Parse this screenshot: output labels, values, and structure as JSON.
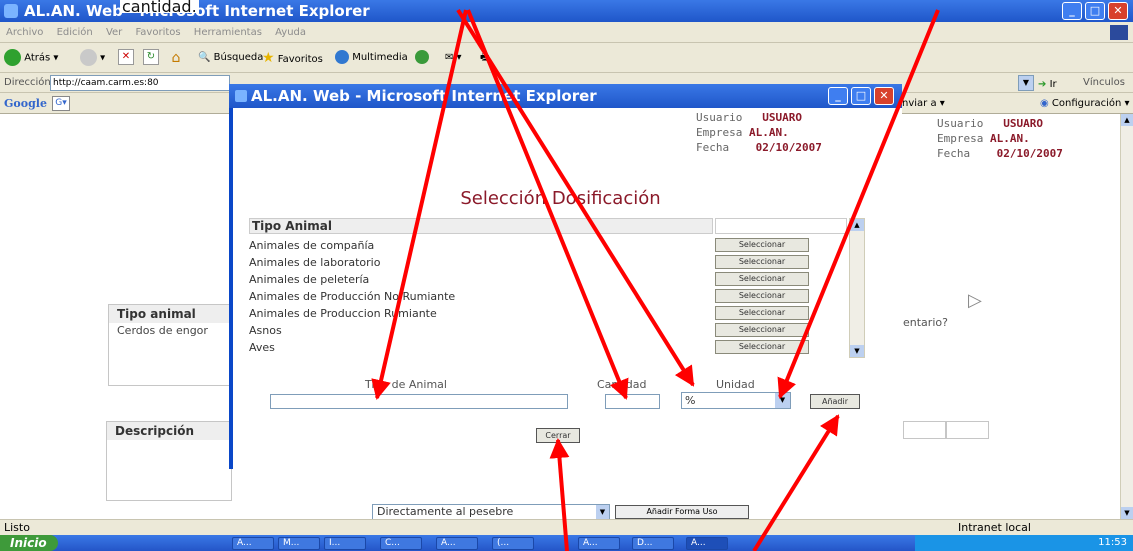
{
  "window": {
    "title": "AL.AN. Web - Microsoft Internet Explorer",
    "menu": [
      "Archivo",
      "Edición",
      "Ver",
      "Favoritos",
      "Herramientas",
      "Ayuda"
    ],
    "toolbar": {
      "back": "Atrás",
      "search": "Búsqueda",
      "favorites": "Favoritos",
      "multimedia": "Multimedia"
    },
    "address": {
      "label": "Dirección",
      "value": "http://caam.carm.es:80",
      "go": "Ir",
      "links": "Vínculos"
    },
    "google": {
      "brand": "Google",
      "send": "nviar a",
      "config": "Configuración"
    },
    "status": {
      "text": "Listo",
      "zone": "Intranet local"
    }
  },
  "overlay_text": "cantidad.",
  "background": {
    "user_label": "Usuario",
    "user_value": "USUARO",
    "company_label": "Empresa",
    "company_value": "AL.AN.",
    "date_label": "Fecha",
    "date_value": "02/10/2007",
    "tipo_animal_header": "Tipo animal",
    "tipo_animal_value": "Cerdos de engor",
    "comentario": "entario?",
    "descripcion_header": "Descripción",
    "forma_uso_value": "Directamente al pesebre",
    "add_forma_uso": "Añadir Forma Uso"
  },
  "popup": {
    "title": "AL.AN. Web - Microsoft Internet Explorer",
    "user_label": "Usuario",
    "user_value": "USUARO",
    "company_label": "Empresa",
    "company_value": "AL.AN.",
    "date_label": "Fecha",
    "date_value": "02/10/2007",
    "heading": "Selección Dosificación",
    "table_header": "Tipo Animal",
    "select_label": "Seleccionar",
    "animals": [
      "Animales de compañía",
      "Animales de laboratorio",
      "Animales de peletería",
      "Animales de Producción No Rumiante",
      "Animales de Produccion Rumiante",
      "Asnos",
      "Aves"
    ],
    "form": {
      "tipo_label": "Tipo de Animal",
      "cantidad_label": "Cantidad",
      "unidad_label": "Unidad",
      "unidad_value": "%",
      "add_button": "Añadir",
      "close_button": "Cerrar"
    }
  },
  "taskbar": {
    "start": "Inicio",
    "tasks": [
      "A...",
      "M...",
      "I...",
      "C...",
      "A...",
      "(...",
      "A...",
      "D...",
      "A..."
    ],
    "clock": "11:53"
  },
  "colors": {
    "accent": "#8b1a2a",
    "title_blue": "#1f56c9",
    "arrow": "#ff0000"
  }
}
